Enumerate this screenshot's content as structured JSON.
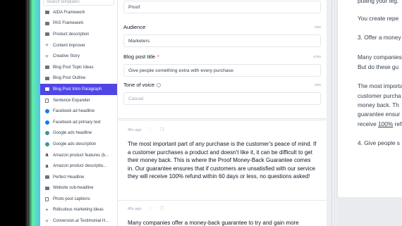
{
  "sidebar": {
    "search_placeholder": "Search templates",
    "items": [
      {
        "label": "AIDA Framework",
        "icon": "speaker-icon"
      },
      {
        "label": "PAS Framework",
        "icon": "speaker-icon"
      },
      {
        "label": "Product description",
        "icon": "box-icon"
      },
      {
        "label": "Content improver",
        "icon": "sparkle-icon"
      },
      {
        "label": "Creative Story",
        "icon": "sparkle-icon"
      },
      {
        "label": "Blog Post Topic Ideas",
        "icon": "speaker-icon"
      },
      {
        "label": "Blog Post Outline",
        "icon": "speaker-icon"
      },
      {
        "label": "Blog Post Intro Paragraph",
        "icon": "speaker-icon",
        "active": true
      },
      {
        "label": "Sentence Expander",
        "icon": "doc-icon"
      },
      {
        "label": "Facebook ad headline",
        "icon": "facebook-icon"
      },
      {
        "label": "Facebook ad primary text",
        "icon": "facebook-icon"
      },
      {
        "label": "Google ads headline",
        "icon": "google-icon"
      },
      {
        "label": "Google ads description",
        "icon": "google-icon"
      },
      {
        "label": "Amazon product features (b...",
        "icon": "amazon-icon"
      },
      {
        "label": "Amazon product descriptio...",
        "icon": "amazon-icon"
      },
      {
        "label": "Perfect Headline",
        "icon": "speaker-icon"
      },
      {
        "label": "Website sub-headline",
        "icon": "speaker-icon"
      },
      {
        "label": "Photo post captions",
        "icon": "camera-icon"
      },
      {
        "label": "Ridiculous marketing ideas",
        "icon": "bulb-icon"
      },
      {
        "label": "Conversion.ai Testimonial H...",
        "icon": "sparkle-icon"
      }
    ]
  },
  "form": {
    "company_value": "Proof",
    "audience_label": "Audience",
    "audience_count": "9/80",
    "audience_value": "Marketers",
    "title_label": "Blog post title",
    "title_required": "*",
    "title_count": "47/80",
    "title_value": "Give people something extra with every purchase",
    "tone_label": "Tone of voice",
    "tone_count": "0/80",
    "tone_placeholder": "Casual"
  },
  "results": [
    {
      "time": "45s ago",
      "text": "The most important part of any purchase is the customer's peace of mind. If a customer purchases a product and doesn't like it, it can be difficult to get their money back. This is where the Proof Money-Back Guarantee comes in. Our guarantee ensures that if customers are unsatisfied with our service they will receive 100% refund within 60 days or less, no questions asked!"
    },
    {
      "time": "45s ago",
      "text": "Many companies offer a money-back guarantee to try and gain more"
    }
  ],
  "document": {
    "lines": [
      "pulling your leg.",
      "You create repe",
      "3. Offer a money",
      "Many companies",
      "But do these gu",
      "The most importa",
      "customer purcha",
      "money back. Th",
      "guarantee ensur",
      "receive ",
      "100%",
      " refun",
      "4. Give people s"
    ]
  }
}
